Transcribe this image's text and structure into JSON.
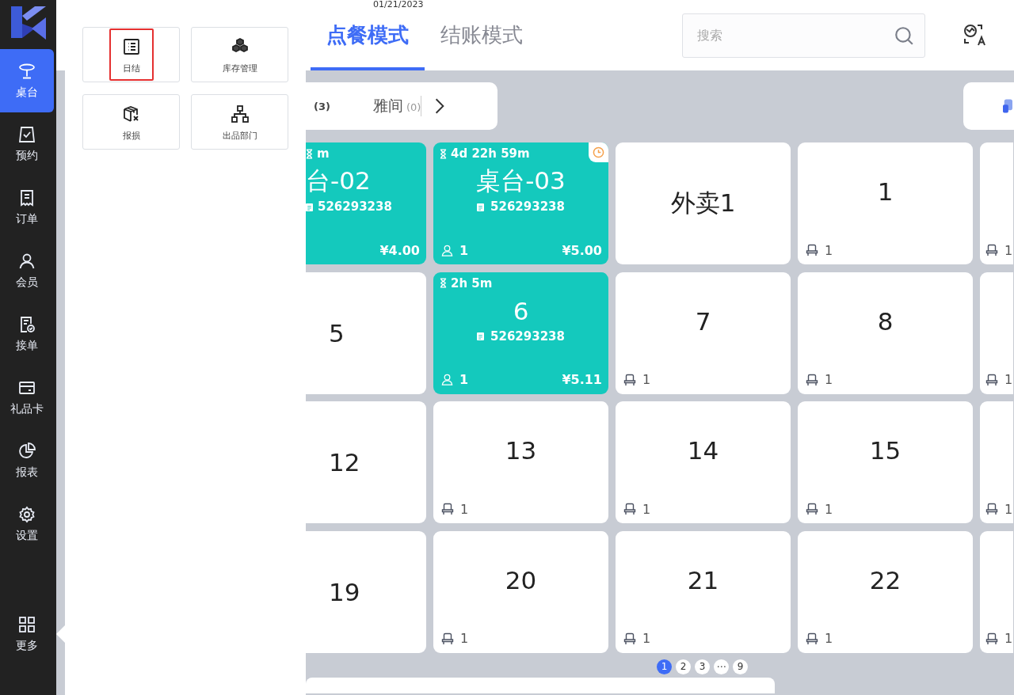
{
  "sidebar": {
    "items": [
      {
        "label": "桌台",
        "selected": true
      },
      {
        "label": "预约",
        "selected": false
      },
      {
        "label": "订单",
        "selected": false
      },
      {
        "label": "会员",
        "selected": false
      },
      {
        "label": "接单",
        "selected": false
      },
      {
        "label": "礼品卡",
        "selected": false
      },
      {
        "label": "报表",
        "selected": false
      },
      {
        "label": "设置",
        "selected": false
      }
    ],
    "more": {
      "label": "更多",
      "selected": false
    }
  },
  "more_panel": {
    "tiles": [
      {
        "label": "日结",
        "selected": true
      },
      {
        "label": "库存管理",
        "selected": false
      },
      {
        "label": "报损",
        "selected": false
      },
      {
        "label": "出品部门",
        "selected": false
      }
    ]
  },
  "header": {
    "date": "01/21/2023",
    "modes": [
      {
        "label": "点餐模式",
        "selected": true
      },
      {
        "label": "结账模式",
        "selected": false
      }
    ],
    "search": {
      "placeholder": "搜索"
    }
  },
  "areas": [
    {
      "count": "(3)"
    },
    {
      "label": "雅间",
      "count": "(0)"
    }
  ],
  "rows": [
    [
      {
        "kind": "occupied",
        "timer": "m",
        "name": "台-02",
        "order": "526293238",
        "price": "¥4.00",
        "alert": false
      },
      {
        "kind": "occupied",
        "timer": "4d 22h 59m",
        "name": "桌台-03",
        "order": "526293238",
        "guests": "1",
        "price": "¥5.00",
        "alert": true
      },
      {
        "kind": "free",
        "name": "外卖1"
      },
      {
        "kind": "free",
        "name": "1",
        "seats": "1"
      },
      {
        "kind": "free",
        "seats": "1"
      }
    ],
    [
      {
        "kind": "free",
        "name": "5"
      },
      {
        "kind": "occupied",
        "timer": "2h 5m",
        "name": "6",
        "order": "526293238",
        "guests": "1",
        "price": "¥5.11",
        "alert": false
      },
      {
        "kind": "free",
        "name": "7",
        "seats": "1"
      },
      {
        "kind": "free",
        "name": "8",
        "seats": "1"
      },
      {
        "kind": "free",
        "seats": "1"
      }
    ],
    [
      {
        "kind": "free",
        "name": "12"
      },
      {
        "kind": "free",
        "name": "13",
        "seats": "1"
      },
      {
        "kind": "free",
        "name": "14",
        "seats": "1"
      },
      {
        "kind": "free",
        "name": "15",
        "seats": "1"
      },
      {
        "kind": "free",
        "seats": "1"
      }
    ],
    [
      {
        "kind": "free",
        "name": "19"
      },
      {
        "kind": "free",
        "name": "20",
        "seats": "1"
      },
      {
        "kind": "free",
        "name": "21",
        "seats": "1"
      },
      {
        "kind": "free",
        "name": "22",
        "seats": "1"
      },
      {
        "kind": "free",
        "seats": "1"
      }
    ]
  ],
  "pagination": [
    {
      "label": "1",
      "selected": true
    },
    {
      "label": "2",
      "selected": false
    },
    {
      "label": "3",
      "selected": false
    },
    {
      "label": "⋯",
      "selected": false
    },
    {
      "label": "9",
      "selected": false
    }
  ]
}
